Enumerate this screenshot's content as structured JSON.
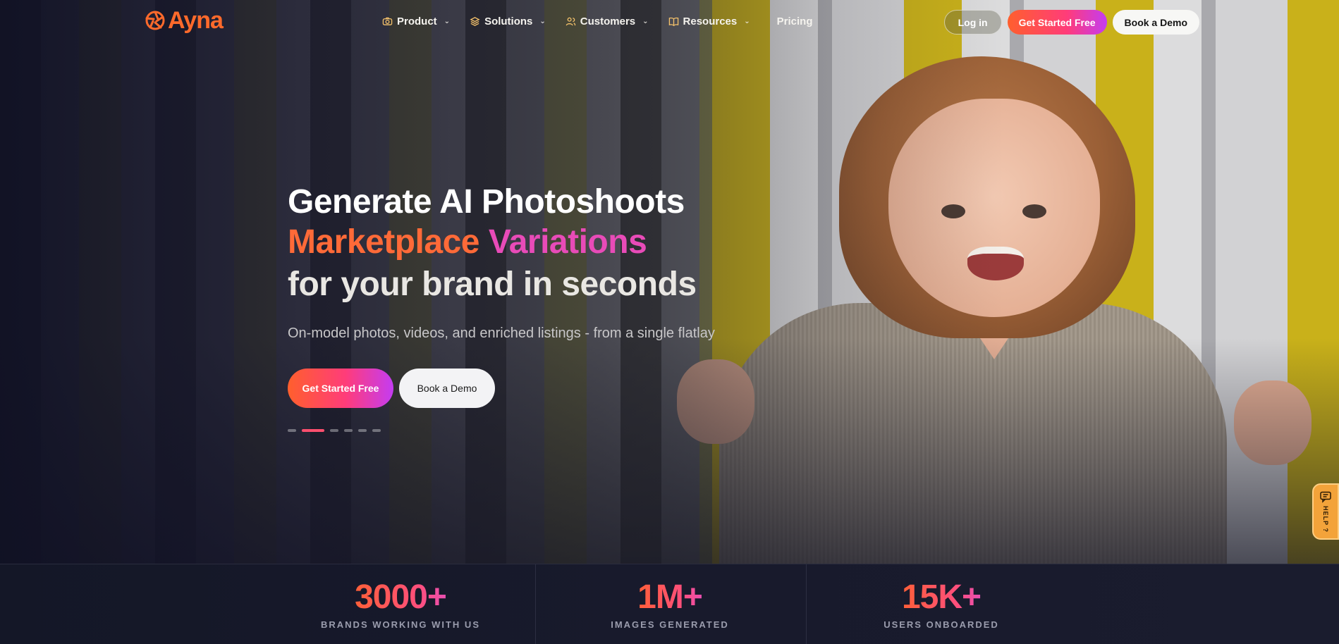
{
  "brand": {
    "name": "Ayna",
    "accent": "#ff6a2b"
  },
  "nav": {
    "items": [
      {
        "label": "Product",
        "icon": "camera-icon",
        "dropdown": true
      },
      {
        "label": "Solutions",
        "icon": "layers-icon",
        "dropdown": true
      },
      {
        "label": "Customers",
        "icon": "users-icon",
        "dropdown": true
      },
      {
        "label": "Resources",
        "icon": "book-icon",
        "dropdown": true
      },
      {
        "label": "Pricing",
        "dropdown": false
      }
    ],
    "login_label": "Log in",
    "get_started_label": "Get Started Free",
    "book_demo_label": "Book a Demo"
  },
  "hero": {
    "line1": "Generate AI Photoshoots",
    "line2_part1": "Marketplace",
    "line2_part2": "Variations",
    "line3": "for your brand in seconds",
    "subtitle": "On-model photos, videos, and enriched listings - from a single flatlay",
    "cta_primary": "Get Started Free",
    "cta_secondary": "Book a Demo",
    "carousel": {
      "total": 6,
      "active_index": 1
    }
  },
  "help": {
    "label": "HELP ?"
  },
  "stats": [
    {
      "value": "3000+",
      "label": "BRANDS WORKING WITH US"
    },
    {
      "value": "1M+",
      "label": "IMAGES GENERATED"
    },
    {
      "value": "15K+",
      "label": "USERS ONBOARDED"
    }
  ],
  "colors": {
    "gradient_start": "#ff5f2d",
    "gradient_mid": "#ff3c7a",
    "gradient_end": "#c43cf2",
    "stats_bg": "#141727"
  }
}
